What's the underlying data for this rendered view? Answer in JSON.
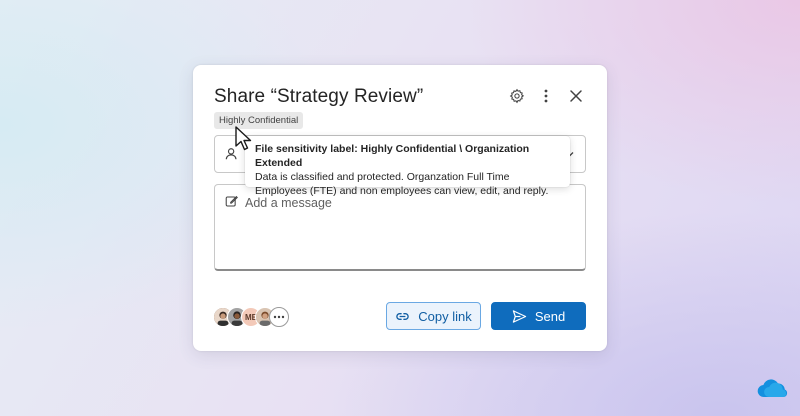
{
  "dialog": {
    "title": "Share “Strategy Review”",
    "sensitivity_badge": "Highly Confidential",
    "header_icons": [
      "gear-icon",
      "more-vertical-icon",
      "close-icon"
    ]
  },
  "tooltip": {
    "title": "File sensitivity label: Highly Confidential \\ Organization Extended",
    "body": "Data is classified and protected. Organzation Full Time Employees (FTE) and non employees can view, edit, and reply."
  },
  "message": {
    "placeholder": "Add a message"
  },
  "avatars": {
    "initials": "ME"
  },
  "buttons": {
    "copy_link": "Copy link",
    "send": "Send"
  },
  "colors": {
    "accent": "#0f6cbd",
    "copy_bg": "#ebf3fc",
    "copy_border": "#6aa8e3"
  }
}
